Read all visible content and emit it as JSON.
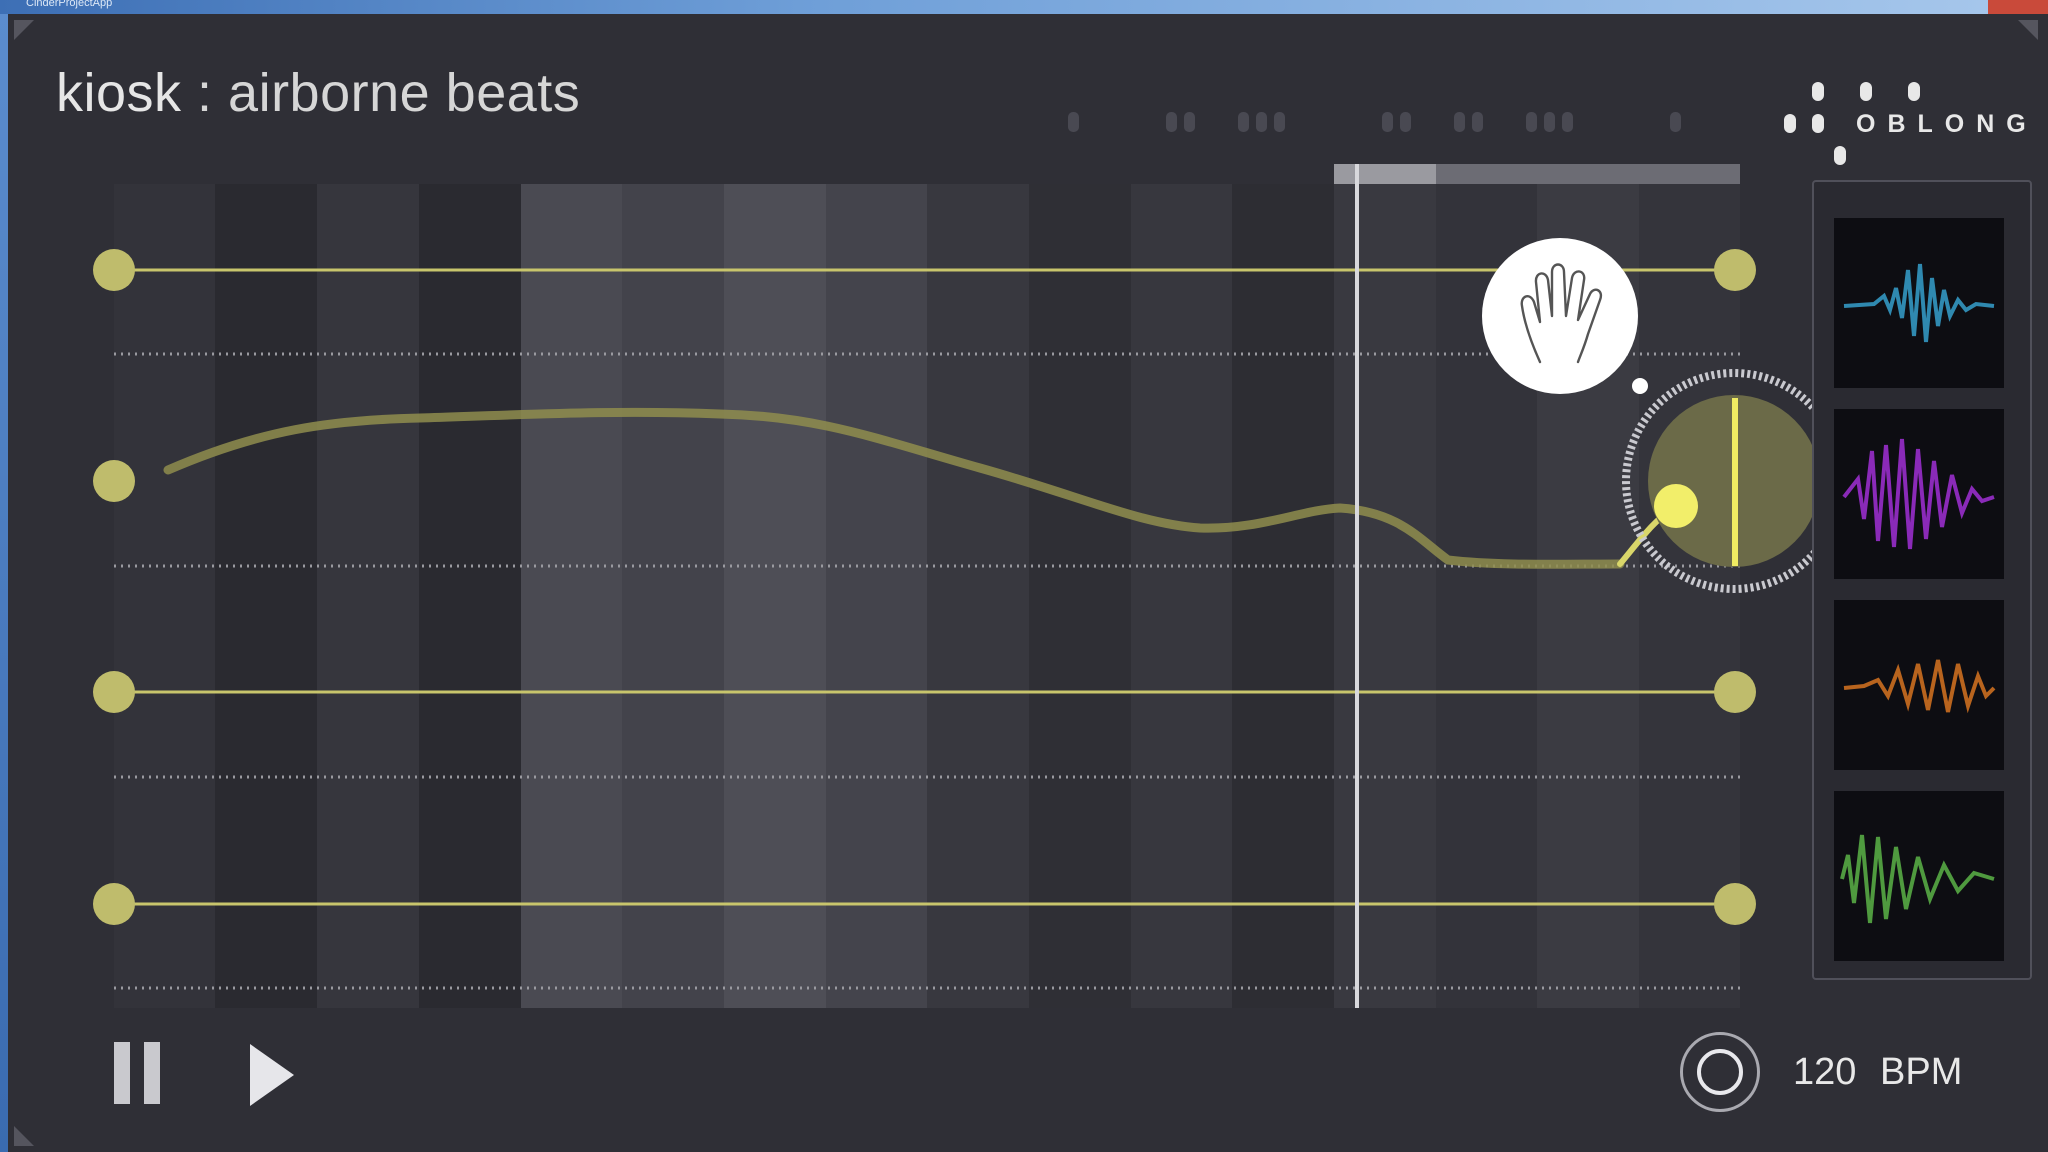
{
  "window": {
    "title": "CinderProjectApp"
  },
  "header": {
    "app": "kiosk",
    "separator": " : ",
    "track": "airborne beats"
  },
  "logo": {
    "text": "OBLONG"
  },
  "sequencer": {
    "tracks": 4,
    "columns": 16,
    "playhead_position": 0.764,
    "active_track": 2,
    "hand_cursor_icon": "hand-icon"
  },
  "samples": [
    {
      "name": "sample-1",
      "color": "#2f89b0"
    },
    {
      "name": "sample-2",
      "color": "#8a2ab8"
    },
    {
      "name": "sample-3",
      "color": "#b8641e"
    },
    {
      "name": "sample-4",
      "color": "#4f9a3f"
    }
  ],
  "transport": {
    "pause_icon": "pause-icon",
    "play_icon": "play-icon"
  },
  "tempo": {
    "value": "120",
    "unit": "BPM",
    "knob_icon": "tempo-knob-icon"
  },
  "colors": {
    "accent": "#d6d37a",
    "bright": "#f2ee6a",
    "panel": "#2f2f36"
  }
}
